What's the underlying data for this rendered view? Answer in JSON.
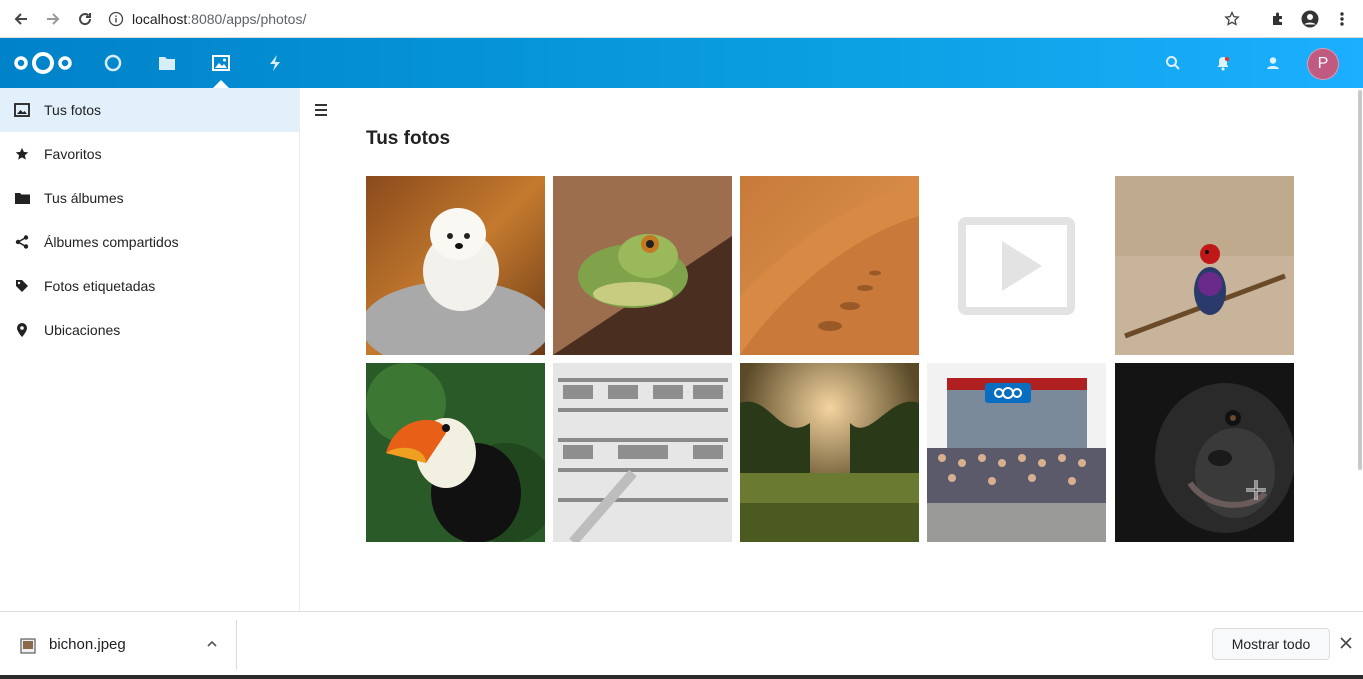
{
  "browser": {
    "url_host": "localhost",
    "url_rest": ":8080/apps/photos/"
  },
  "header": {
    "apps": [
      "dashboard-icon",
      "files-icon",
      "photos-icon",
      "activity-icon"
    ],
    "active_app": "photos",
    "avatar_letter": "P",
    "accent": "#0082c9"
  },
  "sidebar": {
    "items": [
      {
        "label": "Tus fotos",
        "icon": "image-icon",
        "active": true
      },
      {
        "label": "Favoritos",
        "icon": "star-icon",
        "active": false
      },
      {
        "label": "Tus álbumes",
        "icon": "folder-icon",
        "active": false
      },
      {
        "label": "Álbumes compartidos",
        "icon": "share-icon",
        "active": false
      },
      {
        "label": "Fotos etiquetadas",
        "icon": "tag-icon",
        "active": false
      },
      {
        "label": "Ubicaciones",
        "icon": "location-pin-icon",
        "active": false
      }
    ]
  },
  "main": {
    "title": "Tus fotos",
    "photos": [
      {
        "subject": "puppy"
      },
      {
        "subject": "frog"
      },
      {
        "subject": "desert"
      },
      {
        "subject": "video-placeholder"
      },
      {
        "subject": "bird"
      },
      {
        "subject": "toucan"
      },
      {
        "subject": "library"
      },
      {
        "subject": "field"
      },
      {
        "subject": "group-photo"
      },
      {
        "subject": "gorilla"
      }
    ]
  },
  "download_bar": {
    "filename": "bichon.jpeg",
    "show_all": "Mostrar todo"
  }
}
